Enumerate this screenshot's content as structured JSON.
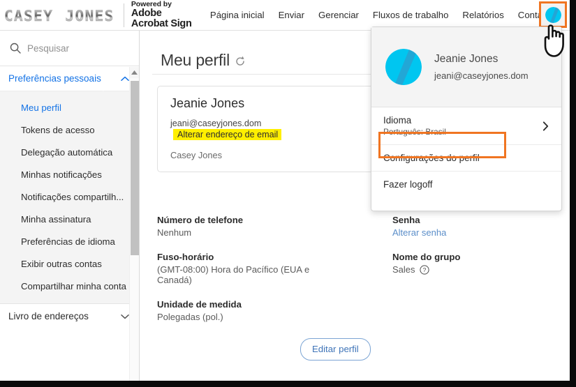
{
  "brand": {
    "logo_text": "CASEY JONES",
    "powered_by": "Powered by",
    "product_line1": "Adobe",
    "product_line2": "Acrobat Sign"
  },
  "nav": {
    "items": [
      {
        "label": "Página inicial",
        "name": "nav-pagina-inicial"
      },
      {
        "label": "Enviar",
        "name": "nav-enviar"
      },
      {
        "label": "Gerenciar",
        "name": "nav-gerenciar"
      },
      {
        "label": "Fluxos de trabalho",
        "name": "nav-fluxos-de-trabalho"
      },
      {
        "label": "Relatórios",
        "name": "nav-relatorios"
      },
      {
        "label": "Conta",
        "name": "nav-conta"
      }
    ],
    "help_icon": "question-circle-icon",
    "avatar_icon": "user-avatar-icon"
  },
  "sidebar": {
    "search": {
      "placeholder": "Pesquisar",
      "value": "",
      "icon": "search-icon"
    },
    "groups": [
      {
        "label": "Preferências pessoais",
        "expanded": true,
        "chevron": "chevron-up-icon",
        "items": [
          {
            "label": "Meu perfil",
            "active": true
          },
          {
            "label": "Tokens de acesso",
            "active": false
          },
          {
            "label": "Delegação automática",
            "active": false
          },
          {
            "label": "Minhas notificações",
            "active": false
          },
          {
            "label": "Notificações compartilh...",
            "active": false
          },
          {
            "label": "Minha assinatura",
            "active": false
          },
          {
            "label": "Preferências de idioma",
            "active": false
          },
          {
            "label": "Exibir outras contas",
            "active": false
          },
          {
            "label": "Compartilhar minha conta",
            "active": false
          }
        ]
      },
      {
        "label": "Livro de endereços",
        "expanded": false,
        "chevron": "chevron-down-icon",
        "items": []
      }
    ],
    "scrollbar": {
      "up_arrow_icon": "scroll-up-arrow-icon"
    }
  },
  "main": {
    "page_title": "Meu perfil",
    "refresh_icon": "refresh-icon",
    "profile_card": {
      "name": "Jeanie Jones",
      "email": "jeani@caseyjones.dom",
      "change_email_link": "Alterar endereço de email",
      "organization": "Casey Jones"
    },
    "fields_left": [
      {
        "label": "Número de telefone",
        "value": "Nenhum"
      },
      {
        "label": "Fuso-horário",
        "value": "(GMT-08:00) Hora do Pacífico (EUA e Canadá)"
      },
      {
        "label": "Unidade de medida",
        "value": "Polegadas (pol.)"
      }
    ],
    "fields_right": [
      {
        "label": "Senha",
        "value": "Alterar senha",
        "is_link": true
      },
      {
        "label": "Nome do grupo",
        "value": "Sales",
        "has_help": true,
        "help_icon": "question-circle-icon"
      }
    ],
    "edit_button": "Editar perfil"
  },
  "dropdown": {
    "user_name": "Jeanie Jones",
    "user_email": "jeani@caseyjones.dom",
    "avatar_icon": "user-avatar-icon",
    "language_label": "Idioma",
    "language_value": "Português: Brasil",
    "language_arrow_icon": "chevron-right-icon",
    "profile_settings": "Configurações do perfil",
    "logoff": "Fazer logoff"
  },
  "annotations": {
    "highlight_color": "#f07522",
    "marker_color": "#ffef00",
    "accent_blue": "#1473e6",
    "avatar_cyan": "#00c6f0",
    "avatar_cyan_dark": "#29a8d4"
  }
}
